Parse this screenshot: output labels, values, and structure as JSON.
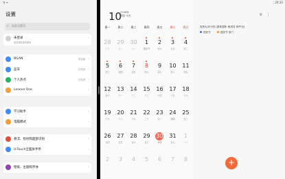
{
  "status": {
    "left": "⇅ ᯤ",
    "time": "⬚24:32"
  },
  "settings": {
    "title": "设置",
    "search_placeholder": "搜索设置项",
    "account": {
      "name": "未登录",
      "sub": "登录获取更多服务"
    },
    "group1": [
      {
        "label": "WLAN",
        "value": "未连接",
        "icon": "wifi-icon",
        "color": "#3d8bfd"
      },
      {
        "label": "蓝牙",
        "value": "已关闭",
        "icon": "bluetooth-icon",
        "color": "#3d8bfd"
      },
      {
        "label": "个人热点",
        "value": "已关闭",
        "icon": "hotspot-icon",
        "color": "#28b463"
      },
      {
        "label": "Lenovo One",
        "value": "",
        "icon": "lenovo-one-icon",
        "color": "#f39c3a"
      }
    ],
    "group2": [
      {
        "label": "学习助手",
        "icon": "study-icon",
        "color": "#3d8bfd"
      },
      {
        "label": "电脑模式",
        "icon": "pc-mode-icon",
        "color": "#f39c3a"
      }
    ],
    "group3": [
      {
        "label": "悬浮、指纹和面部识别",
        "icon": "fingerprint-icon",
        "color": "#e74c3c"
      },
      {
        "label": "U-Touch全面屏手势",
        "icon": "gesture-icon",
        "color": "#3d8bfd"
      }
    ],
    "group4": [
      {
        "label": "壁纸、主题和字体",
        "icon": "theme-icon",
        "color": "#8e44ad"
      }
    ]
  },
  "calendar": {
    "day": "10",
    "meta_line1": "2008年",
    "meta_line2": "周四 今天",
    "weekdays": [
      "周一",
      "周二",
      "周三",
      "周四",
      "周五",
      "周六",
      "周日"
    ],
    "weeks": [
      [
        {
          "n": "28",
          "l": "廿五",
          "dim": true
        },
        {
          "n": "29",
          "l": "廿六",
          "dim": true
        },
        {
          "n": "30",
          "l": "廿七",
          "dim": true
        },
        {
          "n": "1",
          "l": "国庆节",
          "dot": true
        },
        {
          "n": "2",
          "l": "廿九",
          "dot": true
        },
        {
          "n": "3",
          "l": "九月",
          "dot": true
        },
        {
          "n": "4",
          "l": "初二",
          "dot": true
        }
      ],
      [
        {
          "n": "5",
          "l": "初三",
          "dot": true
        },
        {
          "n": "6",
          "l": "初四",
          "dot": true
        },
        {
          "n": "7",
          "l": "初五",
          "dot": true
        },
        {
          "n": "8",
          "l": "初六",
          "dot": true,
          "red": true
        },
        {
          "n": "9",
          "l": "初七"
        },
        {
          "n": "10",
          "l": "初八"
        },
        {
          "n": "11",
          "l": "初九"
        }
      ],
      [
        {
          "n": "12",
          "l": "初十"
        },
        {
          "n": "13",
          "l": "十一"
        },
        {
          "n": "14",
          "l": "十二"
        },
        {
          "n": "15",
          "l": "十三"
        },
        {
          "n": "16",
          "l": "十四"
        },
        {
          "n": "17",
          "l": "十五"
        },
        {
          "n": "18",
          "l": "十六"
        }
      ],
      [
        {
          "n": "19",
          "l": "十七"
        },
        {
          "n": "20",
          "l": "十八"
        },
        {
          "n": "21",
          "l": "十九"
        },
        {
          "n": "22",
          "l": "二十"
        },
        {
          "n": "23",
          "l": "廿一"
        },
        {
          "n": "24",
          "l": "霜降"
        },
        {
          "n": "25",
          "l": "廿三"
        }
      ],
      [
        {
          "n": "26",
          "l": "廿四"
        },
        {
          "n": "27",
          "l": "廿五"
        },
        {
          "n": "28",
          "l": "廿六"
        },
        {
          "n": "29",
          "l": "廿七"
        },
        {
          "n": "30",
          "l": "今日",
          "sel": true
        },
        {
          "n": "31",
          "l": "廿九"
        },
        {
          "n": "1",
          "l": "十月",
          "dim": true
        }
      ],
      [
        {
          "n": "2",
          "l": "",
          "dim": true
        },
        {
          "n": "3",
          "l": "",
          "dim": true
        },
        {
          "n": "4",
          "l": "",
          "dim": true
        },
        {
          "n": "5",
          "l": "",
          "dim": true
        },
        {
          "n": "6",
          "l": "",
          "dim": true
        },
        {
          "n": "7",
          "l": "",
          "dim": true
        },
        {
          "n": "8",
          "l": "",
          "dim": true
        }
      ]
    ]
  },
  "detail": {
    "lunar_info": "农历九月十四 (鼠年鼠年 丙戌月 丙午日)",
    "event1": "国庆节",
    "event2": "国庆节 部门",
    "fab": "+"
  }
}
